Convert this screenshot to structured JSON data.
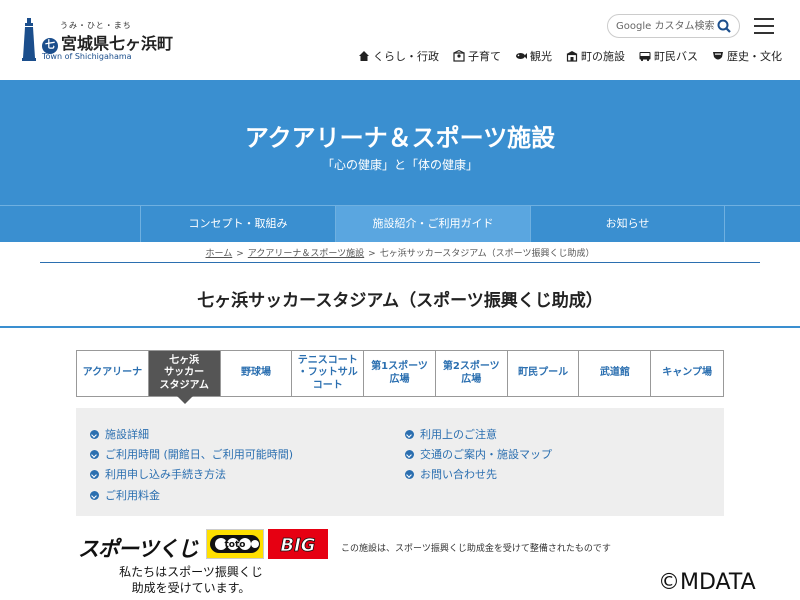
{
  "header": {
    "kana": "うみ・ひと・まち",
    "town_name": "宮城県七ヶ浜町",
    "town_mark": "七",
    "english_name": "Town of Shichigahama",
    "search_placeholder": "Google カスタム検索",
    "nav": [
      {
        "label": "くらし・行政",
        "icon": "house-icon"
      },
      {
        "label": "子育て",
        "icon": "child-icon"
      },
      {
        "label": "観光",
        "icon": "fish-icon"
      },
      {
        "label": "町の施設",
        "icon": "building-icon"
      },
      {
        "label": "町民バス",
        "icon": "bus-icon"
      },
      {
        "label": "歴史・文化",
        "icon": "history-icon"
      }
    ]
  },
  "hero": {
    "title": "アクアリーナ＆スポーツ施設",
    "subtitle": "「心の健康」と「体の健康」"
  },
  "subnav": {
    "tabs": [
      {
        "label": "コンセプト・取組み",
        "active": false
      },
      {
        "label": "施設紹介・ご利用ガイド",
        "active": true
      },
      {
        "label": "お知らせ",
        "active": false
      }
    ]
  },
  "breadcrumb": {
    "home": "ホーム",
    "parent": "アクアリーナ＆スポーツ施設",
    "current": "七ヶ浜サッカースタジアム（スポーツ振興くじ助成）",
    "separator": ">"
  },
  "page_title": "七ヶ浜サッカースタジアム（スポーツ振興くじ助成）",
  "facility_tabs": [
    {
      "label": "アクアリーナ",
      "active": false
    },
    {
      "label": "七ヶ浜\nサッカー\nスタジアム",
      "active": true
    },
    {
      "label": "野球場",
      "active": false
    },
    {
      "label": "テニスコート\n・フットサル\nコート",
      "active": false
    },
    {
      "label": "第1スポーツ\n広場",
      "active": false
    },
    {
      "label": "第2スポーツ\n広場",
      "active": false
    },
    {
      "label": "町民プール",
      "active": false
    },
    {
      "label": "武道館",
      "active": false
    },
    {
      "label": "キャンプ場",
      "active": false
    }
  ],
  "info_links_left": [
    "施設詳細",
    "ご利用時間 (開館日、ご利用可能時間)",
    "利用申し込み手続き方法",
    "ご利用料金"
  ],
  "info_links_right": [
    "利用上のご注意",
    "交通のご案内・施設マップ",
    "お問い合わせ先"
  ],
  "footer": {
    "sports_kuji": "スポーツくじ",
    "toto_label": "toto",
    "big_label": "BIG",
    "notice": "この施設は、スポーツ振興くじ助成金を受けて整備されたものです",
    "support_line1": "私たちはスポーツ振興くじ",
    "support_line2": "助成を受けています。",
    "copyright": "©MDATA"
  },
  "colors": {
    "primary_blue": "#3a8fd0",
    "link_blue": "#2b6fb0",
    "active_tab": "#555555",
    "toto_yellow": "#ffe000",
    "big_red": "#e60012"
  }
}
